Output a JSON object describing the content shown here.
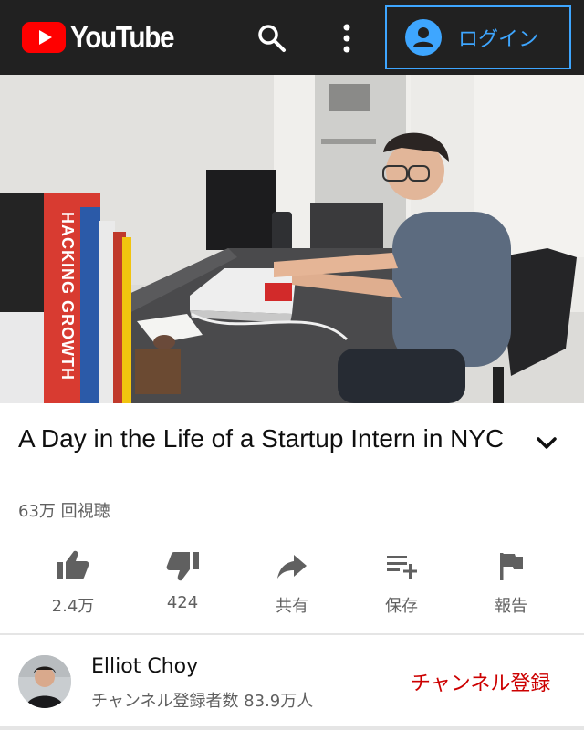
{
  "header": {
    "logo_text": "YouTube",
    "login_label": "ログイン",
    "accent_color": "#3ea6ff",
    "brand_color": "#ff0000"
  },
  "video": {
    "title": "A Day in the Life of a Startup Intern in NYC",
    "views": "63万 回視聴",
    "book_spine_text": "HACKING GROWTH"
  },
  "actions": {
    "like": "2.4万",
    "dislike": "424",
    "share": "共有",
    "save": "保存",
    "report": "報告"
  },
  "channel": {
    "name": "Elliot Choy",
    "subscribers": "チャンネル登録者数 83.9万人",
    "subscribe_label": "チャンネル登録",
    "subscribe_color": "#cc0000"
  },
  "icons": [
    "youtube-logo-icon",
    "search-icon",
    "more-vert-icon",
    "account-circle-icon",
    "chevron-down-icon",
    "thumb-up-icon",
    "thumb-down-icon",
    "share-icon",
    "playlist-add-icon",
    "flag-icon"
  ]
}
